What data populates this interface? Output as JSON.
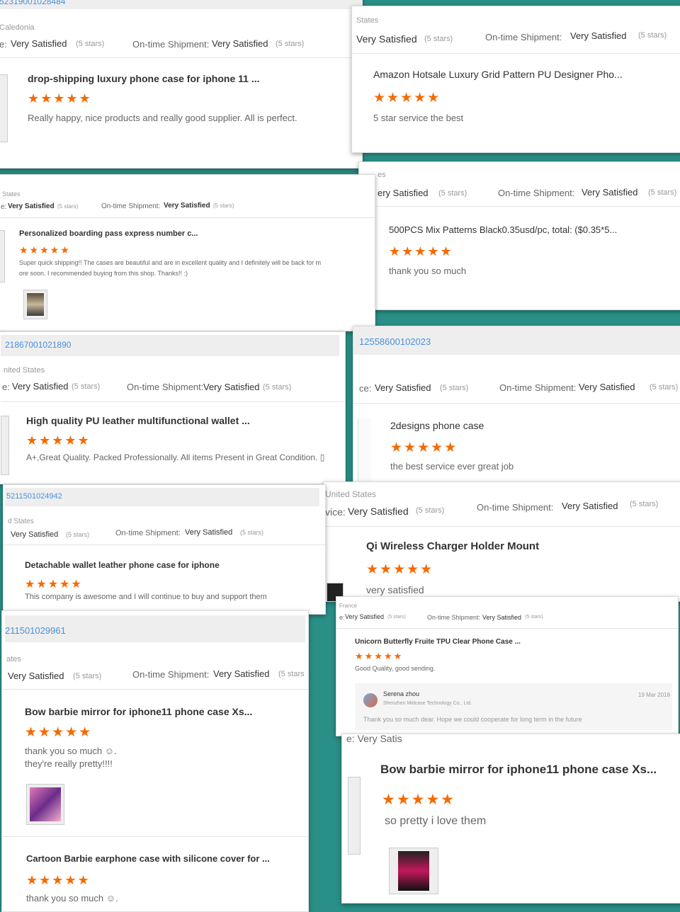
{
  "colors": {
    "star": "#f56a00",
    "link": "#4a90d9",
    "background": "#2a8f86"
  },
  "stars": "★★★★★",
  "cards": {
    "c1": {
      "order_no": "52319001028484",
      "country": "Caledonia",
      "seller_label": "e:",
      "seller_rating": "Very Satisfied",
      "seller_stars": "(5 stars)",
      "shipment_label": "On-time Shipment:",
      "shipment_rating": "Very Satisfied",
      "shipment_stars": "(5 stars)",
      "product": "drop-shipping luxury phone case for iphone 11 ...",
      "review": "Really happy, nice products and really good supplier. All is perfect."
    },
    "c2": {
      "country": "States",
      "seller_rating": "Very Satisfied",
      "seller_stars": "(5 stars)",
      "shipment_label": "On-time Shipment:",
      "shipment_rating": "Very Satisfied",
      "shipment_stars": "(5 stars)",
      "product": "Amazon Hotsale Luxury Grid Pattern PU Designer Pho...",
      "review": "5 star service the best"
    },
    "c3": {
      "country": "States",
      "seller_label": "e:",
      "seller_rating": "Very Satisfied",
      "seller_stars": "(5 stars)",
      "shipment_label": "On-time Shipment:",
      "shipment_rating": "Very Satisfied",
      "shipment_stars": "(5 stars)",
      "product": "Personalized boarding pass express number c...",
      "review_line1": "Super quick shipping!! The cases are beautiful and are in excellent quality and I definitely will be back for m",
      "review_line2": "ore soon. I recommended buying from this shop. Thanks!! :)"
    },
    "c4": {
      "country": "es",
      "seller_rating": "ery Satisfied",
      "seller_stars": "(5 stars)",
      "shipment_label": "On-time Shipment:",
      "shipment_rating": "Very Satisfied",
      "shipment_stars": "(5 stars)",
      "product": "500PCS Mix Patterns Black0.35usd/pc, total: ($0.35*5...",
      "review": "thank you so much"
    },
    "c5": {
      "order_no": "21867001021890",
      "country": "nited States",
      "seller_label": "e:",
      "seller_rating": "Very Satisfied",
      "seller_stars": "(5 stars)",
      "shipment_label": "On-time Shipment:",
      "shipment_rating": "Very Satisfied",
      "shipment_stars": "(5 stars)",
      "product": "High quality PU leather multifunctional wallet ...",
      "review": "A+,Great Quality. Packed Professionally. All items Present in Great Condition. ▯"
    },
    "c6": {
      "order_no": "12558600102023",
      "seller_label": "ce:",
      "seller_rating": "Very Satisfied",
      "seller_stars": "(5 stars)",
      "shipment_label": "On-time Shipment:",
      "shipment_rating": "Very Satisfied",
      "shipment_stars": "(5 stars)",
      "product": "2designs phone case",
      "review": "the best service ever great job"
    },
    "c7": {
      "order_no": "5211501024942",
      "country": "d States",
      "seller_rating": "Very Satisfied",
      "seller_stars": "(5 stars)",
      "shipment_label": "On-time Shipment:",
      "shipment_rating": "Very Satisfied",
      "shipment_stars": "(5 stars)",
      "product": "Detachable wallet leather phone case for iphone",
      "review": "This company is awesome and I will continue to buy and support them"
    },
    "c8": {
      "country": "United States",
      "seller_label": "vice:",
      "seller_rating": "Very Satisfied",
      "seller_stars": "(5 stars)",
      "shipment_label": "On-time Shipment:",
      "shipment_rating": "Very Satisfied",
      "shipment_stars": "(5 stars)",
      "product": "Qi Wireless Charger Holder Mount",
      "review": "very satisfied"
    },
    "c9": {
      "country": "France",
      "seller_label": "e:",
      "seller_rating": "Very Satisfied",
      "seller_stars": "(5 stars)",
      "shipment_label": "On-time Shipment:",
      "shipment_rating": "Very Satisfied",
      "shipment_stars": "(5 stars)",
      "product": "Unicorn Butterfly Fruite TPU Clear Phone Case ...",
      "review": "Good Quality, good sending.",
      "reply_name": "Serena zhou",
      "reply_company": "Shenzhen Midcase Technology Co., Ltd.",
      "reply_date": "19 Mar 2018",
      "reply_text": "Thank you so much dear. Hope we could cooperate for long term in the future"
    },
    "c10": {
      "order_no": "211501029961",
      "country": "ates",
      "seller_rating": "Very Satisfied",
      "seller_stars": "(5 stars)",
      "shipment_label": "On-time Shipment:",
      "shipment_rating": "Very Satisfied",
      "shipment_stars": "(5 stars",
      "product": "Bow barbie mirror for iphone11 phone case Xs...",
      "review_line1": "thank you so much ☺.",
      "review_line2": "they're really pretty!!!!",
      "product2": "Cartoon Barbie earphone case with silicone cover for ...",
      "review2": "thank you so much ☺."
    },
    "c11": {
      "seller_fragment": "e: Very Satis",
      "product": "Bow barbie mirror for iphone11 phone case Xs...",
      "review": "so pretty i love them"
    }
  }
}
